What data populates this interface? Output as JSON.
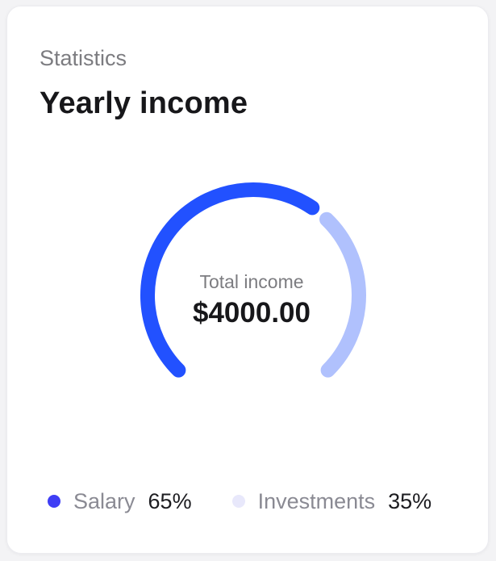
{
  "card": {
    "eyebrow": "Statistics",
    "title": "Yearly income"
  },
  "center": {
    "label": "Total income",
    "value": "$4000.00"
  },
  "colors": {
    "salary": "#2251ff",
    "investments": "#b0c1fd",
    "salary_dot": "#3f3ef5",
    "investments_dot": "#e8e8fb"
  },
  "legend": [
    {
      "name": "Salary",
      "pct": "65%"
    },
    {
      "name": "Investments",
      "pct": "35%"
    }
  ],
  "chart_data": {
    "type": "pie",
    "categories": [
      "Salary",
      "Investments"
    ],
    "values": [
      65,
      35
    ],
    "total": 4000.0
  }
}
